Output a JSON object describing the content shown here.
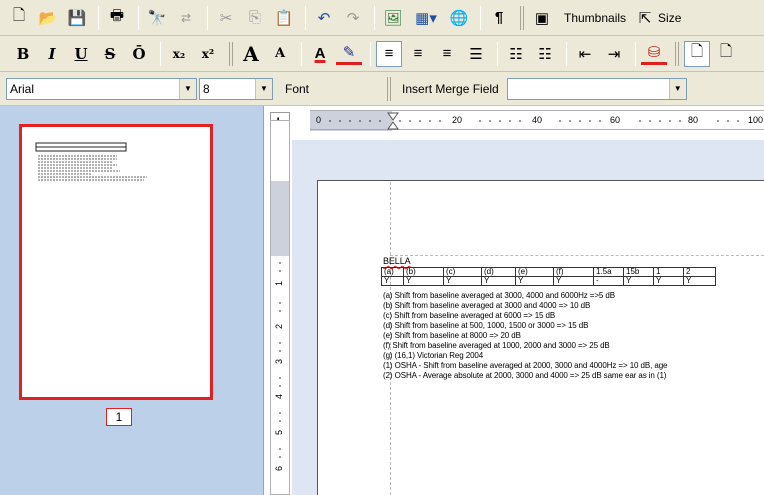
{
  "toolbar1": {
    "thumbnails_label": "Thumbnails",
    "size_label": "Size"
  },
  "toolbar2": {
    "bold": "B",
    "italic": "I",
    "underline": "U",
    "strike": "S",
    "overline": "Ō",
    "subscript": "x₂",
    "superscript": "x²",
    "grow_font": "A",
    "shrink_font": "A"
  },
  "toolbar3": {
    "font_name": "Arial",
    "font_size": "8",
    "font_label": "Font",
    "merge_label": "Insert Merge Field",
    "merge_value": ""
  },
  "ruler": {
    "corner": "L",
    "h_marks": [
      "0",
      "20",
      "40",
      "60",
      "80",
      "100"
    ],
    "v_marks": [
      "1",
      "2",
      "3",
      "4",
      "5",
      "6"
    ]
  },
  "thumbnail": {
    "page_number": "1"
  },
  "document": {
    "heading": "BELLA",
    "table_headers": [
      "(a)",
      "(b)",
      "(c)",
      "(d)",
      "(e)",
      "(f)",
      "1.5a",
      "15b",
      "1",
      "2"
    ],
    "table_values": [
      "Y",
      "Y",
      "Y",
      "Y",
      "Y",
      "Y",
      "-",
      "Y",
      "Y",
      "Y"
    ],
    "lines": [
      "(a)  Shift from baseline averaged at 3000, 4000 and 6000Hz =>5 dB",
      "(b)  Shift from baseline averaged at 3000 and 4000 => 10 dB",
      "(c)  Shift from baseline averaged at 6000 => 15 dB",
      "(d)  Shift from baseline at 500, 1000, 1500 or 3000 => 15 dB",
      "(e)  Shift from baseline at 8000 => 20 dB",
      "(f)   Shift from baseline averaged at 1000, 2000 and 3000 => 25 dB",
      "(g)         (16,1)  Victorian Reg 2004",
      "(1) OSHA - Shift from baseline averaged at 2000, 3000 and 4000Hz => 10 dB, age",
      "(2) OSHA - Average absolute at 2000, 3000 and 4000 => 25 dB same ear as in (1)"
    ]
  }
}
